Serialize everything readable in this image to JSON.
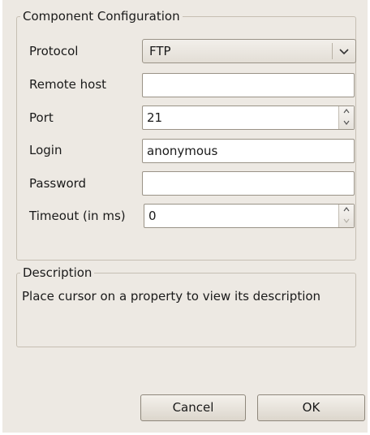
{
  "config": {
    "title": "Component Configuration",
    "protocol_label": "Protocol",
    "protocol_value": "FTP",
    "remote_host_label": "Remote host",
    "remote_host_value": "",
    "port_label": "Port",
    "port_value": "21",
    "login_label": "Login",
    "login_value": "anonymous",
    "password_label": "Password",
    "password_value": "",
    "timeout_label": "Timeout (in ms)",
    "timeout_value": "0"
  },
  "description": {
    "title": "Description",
    "text": "Place cursor on a property to view its description"
  },
  "buttons": {
    "cancel": "Cancel",
    "ok": "OK"
  },
  "icons": {
    "protocol_dropdown": "chevron-down-icon",
    "spin_up": "chevron-up-icon",
    "spin_down": "chevron-down-icon"
  }
}
